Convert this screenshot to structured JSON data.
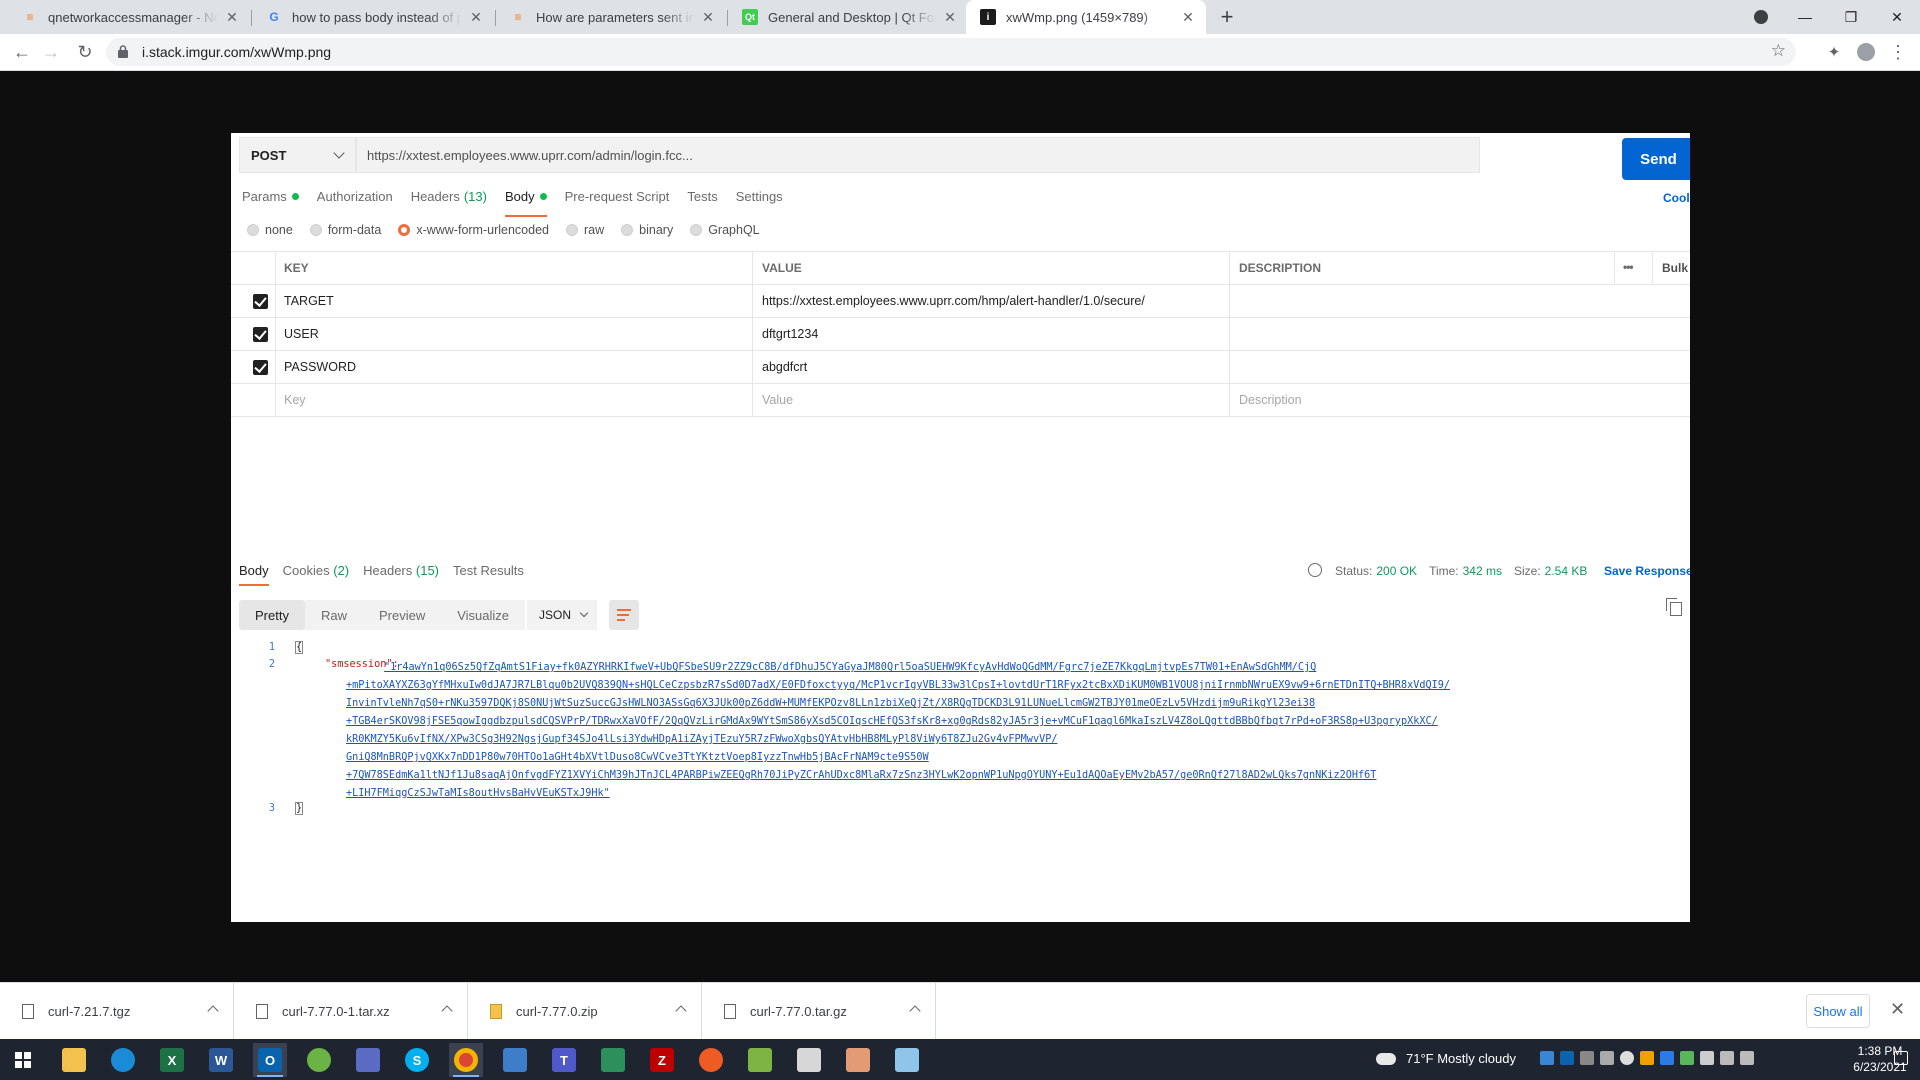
{
  "browser": {
    "tabs": [
      {
        "title": "qnetworkaccessmanager - Not g",
        "favicon": "stackoverflow-icon"
      },
      {
        "title": "how to pass body instead of para",
        "favicon": "google-icon"
      },
      {
        "title": "How are parameters sent in an H",
        "favicon": "stackoverflow-icon"
      },
      {
        "title": "General and Desktop | Qt Forum",
        "favicon": "qt-icon"
      },
      {
        "title": "xwWmp.png (1459×789)",
        "favicon": "imgur-icon"
      }
    ],
    "url": "i.stack.imgur.com/xwWmp.png"
  },
  "postman": {
    "method": "POST",
    "request_url": "https://xxtest.employees.www.uprr.com/admin/login.fcc...",
    "send_label": "Send",
    "tabs": [
      {
        "label": "Params",
        "dot": true
      },
      {
        "label": "Authorization"
      },
      {
        "label": "Headers",
        "count": "(13)"
      },
      {
        "label": "Body",
        "dot": true
      },
      {
        "label": "Pre-request Script"
      },
      {
        "label": "Tests"
      },
      {
        "label": "Settings"
      }
    ],
    "cookies_label": "Cool",
    "body_types": [
      "none",
      "form-data",
      "x-www-form-urlencoded",
      "raw",
      "binary",
      "GraphQL"
    ],
    "selected_body_type": "x-www-form-urlencoded",
    "table_headers": {
      "key": "KEY",
      "value": "VALUE",
      "description": "DESCRIPTION",
      "bulk": "Bulk"
    },
    "rows": [
      {
        "key": "TARGET",
        "value": "https://xxtest.employees.www.uprr.com/hmp/alert-handler/1.0/secure/",
        "checked": true
      },
      {
        "key": "USER",
        "value": "dftgrt1234",
        "checked": true
      },
      {
        "key": "PASSWORD",
        "value": "abgdfcrt",
        "checked": true
      }
    ],
    "placeholder_row": {
      "key": "Key",
      "value": "Value",
      "description": "Description"
    },
    "response": {
      "tabs": [
        {
          "label": "Body"
        },
        {
          "label": "Cookies",
          "count": "(2)"
        },
        {
          "label": "Headers",
          "count": "(15)"
        },
        {
          "label": "Test Results"
        }
      ],
      "status_label": "Status:",
      "status_value": "200 OK",
      "time_label": "Time:",
      "time_value": "342 ms",
      "size_label": "Size:",
      "size_value": "2.54 KB",
      "save_label": "Save Response",
      "view_modes": [
        "Pretty",
        "Raw",
        "Preview",
        "Visualize"
      ],
      "format": "JSON",
      "line_numbers": [
        "1",
        "2",
        "3"
      ],
      "open_brace": "{",
      "close_brace": "}",
      "json_key": "\"smsession\":",
      "json_value_lines": [
        "\"1r4awYn1q06Sz5QfZqAmtS1Fiay+fk0AZYRHRKIfweV+UbQFSbeSU9r2ZZ9cC8B/dfDhuJ5CYaGyaJM80Qrl5oaSUEHW9KfcyAvHdWoQGdMM/Fgrc7jeZE7KkgqLmjtvpEs7TW01+EnAwSdGhMM/CjQ",
        "+mPitoXAYXZ63gYfMHxuIw0dJA7JR7LBlqu0b2UVQ839QN+sHQLCeCzpsbzR7sSd0D7adX/E0FDfoxctyyq/McP1vcrIgyVBL33w3lCpsI+lovtdUrT1RFyx2tcBxXDiKUM0WB1VOU8jniIrnmbNWruEX9vw9+6rnETDnITQ+BHR8xVdQI9/",
        "InvinTvleNh7qS0+rNKu3597DQKj8S0NUjWtSuzSuccGJsHWLNO3ASsGq6X3JUk00pZ6ddW+MUMfEKPOzv8LLn1zbiXeQjZt/X8RQgTDCKD3L91LUNueLlcmGW2TBJY01meOEzLv5VHzdijm9uRikgYl23ei38",
        "+TGB4erSKOV98jFSE5qowIggdbzpulsdCQSVPrP/TDRwxXaVOfF/2QqQVzLirGMdAx9WYtSmS86yXsd5COIqscHEfQS3fsKr8+xg0gRds82yJA5r3je+vMCuF1qagl6MkaIszLV4Z8oLQgttdBBbQfbqt7rPd+oF3RS8p+U3pgrypXkXC/",
        "kR0KMZY5Ku6vIfNX/XPw3CSg3H92NgsjGupf34SJo4lLsi3YdwHDpA1iZAyjTEzuY5R7zFWwoXgbsQYAtvHbHB8MLyPl8ViWy6T8ZJu2Gv4vFPMwvVP/",
        "GniQ8MnBRQPjvQXKx7nDD1P80w70HTOo1aGHt4bXVtlDuso8CwVCve3TtYKtztVoep8IyzzTnwHb5jBAcFrNAM9cte9S50W",
        "+7QW78SEdmKa1ltNJf1Ju8saqAjOnfvgdFYZ1XVYiChM39hJTnJCL4PARBPiwZEEQgRh70JiPyZCrAhUDxc8MlaRx7zSnz3HYLwK2opnWP1uNpgOYUNY+Eu1dAQOaEyEMv2bA57/ge0RnQf27l8AD2wLQks7gnNKiz2OHf6T",
        "+LIH7FMiqgCzSJwTaMIs8outHvsBaHvVEuKSTxJ9Hk\""
      ]
    }
  },
  "downloads": {
    "items": [
      {
        "name": "curl-7.21.7.tgz"
      },
      {
        "name": "curl-7.77.0-1.tar.xz"
      },
      {
        "name": "curl-7.77.0.zip"
      },
      {
        "name": "curl-7.77.0.tar.gz"
      }
    ],
    "show_all": "Show all"
  },
  "taskbar": {
    "weather": "71°F  Mostly cloudy",
    "time": "1:38 PM",
    "date": "6/23/2021",
    "apps": [
      "windows-start-icon",
      "file-explorer-icon",
      "edge-icon",
      "excel-icon",
      "word-icon",
      "outlook-icon",
      "xbox-icon",
      "network-app-icon",
      "skype-icon",
      "chrome-icon",
      "rdp-icon",
      "teams-icon",
      "vm-icon",
      "filezilla-icon",
      "postman-icon",
      "notepad-icon",
      "app-icon",
      "paint-icon",
      "snip-icon"
    ]
  }
}
